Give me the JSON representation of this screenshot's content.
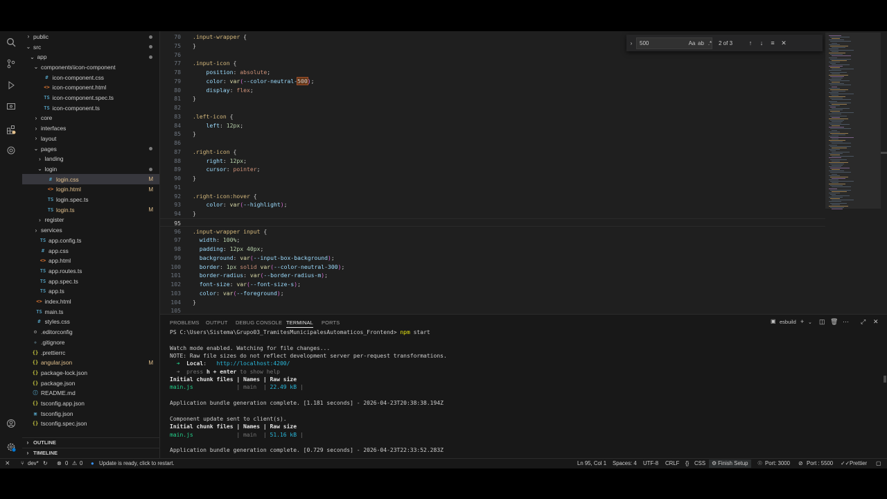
{
  "explorer": {
    "items": [
      {
        "label": "public",
        "icon": "chevron-right",
        "depth": 0,
        "type": "folder",
        "dot": true
      },
      {
        "label": "src",
        "icon": "chevron-down",
        "depth": 0,
        "type": "folder",
        "dot": true
      },
      {
        "label": "app",
        "icon": "chevron-down",
        "depth": 1,
        "type": "folder",
        "dot": true
      },
      {
        "label": "components\\icon-component",
        "icon": "chevron-down",
        "depth": 2,
        "type": "folder"
      },
      {
        "label": "icon-component.css",
        "icon": "css-icon",
        "depth": 3,
        "type": "file"
      },
      {
        "label": "icon-component.html",
        "icon": "html-icon",
        "depth": 3,
        "type": "file"
      },
      {
        "label": "icon-component.spec.ts",
        "icon": "ts-icon",
        "depth": 3,
        "type": "file"
      },
      {
        "label": "icon-component.ts",
        "icon": "ts-icon",
        "depth": 3,
        "type": "file"
      },
      {
        "label": "core",
        "icon": "chevron-right",
        "depth": 2,
        "type": "folder"
      },
      {
        "label": "interfaces",
        "icon": "chevron-right",
        "depth": 2,
        "type": "folder"
      },
      {
        "label": "layout",
        "icon": "chevron-right",
        "depth": 2,
        "type": "folder"
      },
      {
        "label": "pages",
        "icon": "chevron-down",
        "depth": 2,
        "type": "folder",
        "dot": true
      },
      {
        "label": "landing",
        "icon": "chevron-right",
        "depth": 3,
        "type": "folder"
      },
      {
        "label": "login",
        "icon": "chevron-down",
        "depth": 3,
        "type": "folder",
        "dot": true
      },
      {
        "label": "login.css",
        "icon": "css-icon",
        "depth": 4,
        "type": "file",
        "mod": "M",
        "selected": true
      },
      {
        "label": "login.html",
        "icon": "html-icon",
        "depth": 4,
        "type": "file",
        "mod": "M"
      },
      {
        "label": "login.spec.ts",
        "icon": "ts-icon",
        "depth": 4,
        "type": "file"
      },
      {
        "label": "login.ts",
        "icon": "ts-icon",
        "depth": 4,
        "type": "file",
        "mod": "M"
      },
      {
        "label": "register",
        "icon": "chevron-right",
        "depth": 3,
        "type": "folder"
      },
      {
        "label": "services",
        "icon": "chevron-right",
        "depth": 2,
        "type": "folder"
      },
      {
        "label": "app.config.ts",
        "icon": "ts-icon",
        "depth": 2,
        "type": "file"
      },
      {
        "label": "app.css",
        "icon": "css-icon",
        "depth": 2,
        "type": "file"
      },
      {
        "label": "app.html",
        "icon": "html-icon",
        "depth": 2,
        "type": "file"
      },
      {
        "label": "app.routes.ts",
        "icon": "ts-icon",
        "depth": 2,
        "type": "file"
      },
      {
        "label": "app.spec.ts",
        "icon": "ts-icon",
        "depth": 2,
        "type": "file"
      },
      {
        "label": "app.ts",
        "icon": "ts-icon",
        "depth": 2,
        "type": "file"
      },
      {
        "label": "index.html",
        "icon": "html-icon",
        "depth": 1,
        "type": "file"
      },
      {
        "label": "main.ts",
        "icon": "ts-icon",
        "depth": 1,
        "type": "file"
      },
      {
        "label": "styles.css",
        "icon": "css-icon",
        "depth": 1,
        "type": "file"
      },
      {
        "label": ".editorconfig",
        "icon": "gear-icon",
        "depth": 0,
        "type": "file"
      },
      {
        "label": ".gitignore",
        "icon": "git-icon",
        "depth": 0,
        "type": "file"
      },
      {
        "label": ".prettierrc",
        "icon": "json-icon",
        "depth": 0,
        "type": "file"
      },
      {
        "label": "angular.json",
        "icon": "json-icon",
        "depth": 0,
        "type": "file",
        "mod": "M"
      },
      {
        "label": "package-lock.json",
        "icon": "json-icon",
        "depth": 0,
        "type": "file"
      },
      {
        "label": "package.json",
        "icon": "json-icon",
        "depth": 0,
        "type": "file"
      },
      {
        "label": "README.md",
        "icon": "info-icon",
        "depth": 0,
        "type": "file"
      },
      {
        "label": "tsconfig.app.json",
        "icon": "json-icon",
        "depth": 0,
        "type": "file"
      },
      {
        "label": "tsconfig.json",
        "icon": "tsconfig-icon",
        "depth": 0,
        "type": "file"
      },
      {
        "label": "tsconfig.spec.json",
        "icon": "json-icon",
        "depth": 0,
        "type": "file"
      }
    ],
    "outline_label": "OUTLINE",
    "timeline_label": "TIMELINE"
  },
  "editor": {
    "lines": [
      {
        "n": "70",
        "tokens": [
          [
            "sel",
            ".input-wrapper"
          ],
          [
            "punc",
            " {"
          ]
        ]
      },
      {
        "n": "75",
        "tokens": [
          [
            "punc",
            "}"
          ]
        ]
      },
      {
        "n": "76",
        "tokens": []
      },
      {
        "n": "77",
        "tokens": [
          [
            "sel",
            ".input-icon"
          ],
          [
            "punc",
            " {"
          ]
        ]
      },
      {
        "n": "78",
        "tokens": [
          [
            "punc",
            "    "
          ],
          [
            "prop",
            "position"
          ],
          [
            "punc",
            ": "
          ],
          [
            "val",
            "absolute"
          ],
          [
            "punc",
            ";"
          ]
        ]
      },
      {
        "n": "79",
        "tokens": [
          [
            "punc",
            "    "
          ],
          [
            "prop",
            "color"
          ],
          [
            "punc",
            ": "
          ],
          [
            "fn",
            "var"
          ],
          [
            "brace",
            "("
          ],
          [
            "var",
            "--color-neutral-"
          ],
          [
            "hl",
            "500"
          ],
          [
            "brace",
            ")"
          ],
          [
            "punc",
            ";"
          ]
        ]
      },
      {
        "n": "80",
        "tokens": [
          [
            "punc",
            "    "
          ],
          [
            "prop",
            "display"
          ],
          [
            "punc",
            ": "
          ],
          [
            "val",
            "flex"
          ],
          [
            "punc",
            ";"
          ]
        ]
      },
      {
        "n": "81",
        "tokens": [
          [
            "punc",
            "}"
          ]
        ]
      },
      {
        "n": "82",
        "tokens": []
      },
      {
        "n": "83",
        "tokens": [
          [
            "sel",
            ".left-icon"
          ],
          [
            "punc",
            " {"
          ]
        ]
      },
      {
        "n": "84",
        "tokens": [
          [
            "punc",
            "    "
          ],
          [
            "prop",
            "left"
          ],
          [
            "punc",
            ": "
          ],
          [
            "num",
            "12px"
          ],
          [
            "punc",
            ";"
          ]
        ]
      },
      {
        "n": "85",
        "tokens": [
          [
            "punc",
            "}"
          ]
        ]
      },
      {
        "n": "86",
        "tokens": []
      },
      {
        "n": "87",
        "tokens": [
          [
            "sel",
            ".right-icon"
          ],
          [
            "punc",
            " {"
          ]
        ]
      },
      {
        "n": "88",
        "tokens": [
          [
            "punc",
            "    "
          ],
          [
            "prop",
            "right"
          ],
          [
            "punc",
            ": "
          ],
          [
            "num",
            "12px"
          ],
          [
            "punc",
            ";"
          ]
        ]
      },
      {
        "n": "89",
        "tokens": [
          [
            "punc",
            "    "
          ],
          [
            "prop",
            "cursor"
          ],
          [
            "punc",
            ": "
          ],
          [
            "val",
            "pointer"
          ],
          [
            "punc",
            ";"
          ]
        ]
      },
      {
        "n": "90",
        "tokens": [
          [
            "punc",
            "}"
          ]
        ]
      },
      {
        "n": "91",
        "tokens": []
      },
      {
        "n": "92",
        "tokens": [
          [
            "sel",
            ".right-icon:hover"
          ],
          [
            "punc",
            " {"
          ]
        ]
      },
      {
        "n": "93",
        "tokens": [
          [
            "punc",
            "    "
          ],
          [
            "prop",
            "color"
          ],
          [
            "punc",
            ": "
          ],
          [
            "fn",
            "var"
          ],
          [
            "brace",
            "("
          ],
          [
            "var",
            "--highlight"
          ],
          [
            "brace",
            ")"
          ],
          [
            "punc",
            ";"
          ]
        ]
      },
      {
        "n": "94",
        "tokens": [
          [
            "punc",
            "}"
          ]
        ]
      },
      {
        "n": "95",
        "tokens": [],
        "current": true
      },
      {
        "n": "96",
        "tokens": [
          [
            "sel",
            ".input-wrapper input"
          ],
          [
            "punc",
            " {"
          ]
        ]
      },
      {
        "n": "97",
        "tokens": [
          [
            "punc",
            "  "
          ],
          [
            "prop",
            "width"
          ],
          [
            "punc",
            ": "
          ],
          [
            "num",
            "100%"
          ],
          [
            "punc",
            ";"
          ]
        ]
      },
      {
        "n": "98",
        "tokens": [
          [
            "punc",
            "  "
          ],
          [
            "prop",
            "padding"
          ],
          [
            "punc",
            ": "
          ],
          [
            "num",
            "12px 40px"
          ],
          [
            "punc",
            ";"
          ]
        ]
      },
      {
        "n": "99",
        "tokens": [
          [
            "punc",
            "  "
          ],
          [
            "prop",
            "background"
          ],
          [
            "punc",
            ": "
          ],
          [
            "fn",
            "var"
          ],
          [
            "brace",
            "("
          ],
          [
            "var",
            "--input-box-background"
          ],
          [
            "brace",
            ")"
          ],
          [
            "punc",
            ";"
          ]
        ]
      },
      {
        "n": "100",
        "tokens": [
          [
            "punc",
            "  "
          ],
          [
            "prop",
            "border"
          ],
          [
            "punc",
            ": "
          ],
          [
            "num",
            "1px"
          ],
          [
            "val",
            " solid "
          ],
          [
            "fn",
            "var"
          ],
          [
            "brace",
            "("
          ],
          [
            "var",
            "--color-neutral-300"
          ],
          [
            "brace",
            ")"
          ],
          [
            "punc",
            ";"
          ]
        ]
      },
      {
        "n": "101",
        "tokens": [
          [
            "punc",
            "  "
          ],
          [
            "prop",
            "border-radius"
          ],
          [
            "punc",
            ": "
          ],
          [
            "fn",
            "var"
          ],
          [
            "brace",
            "("
          ],
          [
            "var",
            "--border-radius-m"
          ],
          [
            "brace",
            ")"
          ],
          [
            "punc",
            ";"
          ]
        ]
      },
      {
        "n": "102",
        "tokens": [
          [
            "punc",
            "  "
          ],
          [
            "prop",
            "font-size"
          ],
          [
            "punc",
            ": "
          ],
          [
            "fn",
            "var"
          ],
          [
            "brace",
            "("
          ],
          [
            "var",
            "--font-size-s"
          ],
          [
            "brace",
            ")"
          ],
          [
            "punc",
            ";"
          ]
        ]
      },
      {
        "n": "103",
        "tokens": [
          [
            "punc",
            "  "
          ],
          [
            "prop",
            "color"
          ],
          [
            "punc",
            ": "
          ],
          [
            "fn",
            "var"
          ],
          [
            "brace",
            "("
          ],
          [
            "var",
            "--foreground"
          ],
          [
            "brace",
            ")"
          ],
          [
            "punc",
            ";"
          ]
        ]
      },
      {
        "n": "104",
        "tokens": [
          [
            "punc",
            "}"
          ]
        ]
      },
      {
        "n": "105",
        "tokens": []
      }
    ],
    "find": {
      "value": "500",
      "count": "2 of 3",
      "match_case": "Aa",
      "whole_word": "ab",
      "regex": ".*"
    }
  },
  "panel": {
    "tabs": [
      "PROBLEMS",
      "OUTPUT",
      "DEBUG CONSOLE",
      "TERMINAL",
      "PORTS"
    ],
    "active_tab": "TERMINAL",
    "terminal_name": "esbuild",
    "terminal": [
      [
        [
          "",
          "PS C:\\Users\\Sistema\\Grupo03_TramitesMunicipalesAutomaticos_Frontend> "
        ],
        [
          "t-yellow",
          "npm"
        ],
        [
          "",
          " start"
        ]
      ],
      [],
      [
        [
          "",
          "Watch mode enabled. Watching for file changes..."
        ]
      ],
      [
        [
          "",
          "NOTE: Raw file sizes do not reflect development server per-request transformations."
        ]
      ],
      [
        [
          "t-green",
          "  ➜  "
        ],
        [
          "t-bold",
          "Local"
        ],
        [
          "",
          ":   "
        ],
        [
          "t-cyan",
          "http://localhost:4200/"
        ]
      ],
      [
        [
          "t-dim",
          "  ➜  press "
        ],
        [
          "t-bold",
          "h + enter"
        ],
        [
          "t-dim",
          " to show help"
        ]
      ],
      [
        [
          "t-bold",
          "Initial chunk files | Names | Raw size"
        ]
      ],
      [
        [
          "t-green",
          "main.js"
        ],
        [
          "t-dim",
          "             | "
        ],
        [
          "t-dim",
          "main"
        ],
        [
          "t-dim",
          "  | "
        ],
        [
          "t-cyan",
          "22.49 kB"
        ],
        [
          "t-dim",
          " |"
        ]
      ],
      [],
      [
        [
          "",
          "Application bundle generation complete. [1.181 seconds] - 2026-04-23T20:38:38.194Z"
        ]
      ],
      [],
      [
        [
          "",
          "Component update sent to client(s)."
        ]
      ],
      [
        [
          "t-bold",
          "Initial chunk files | Names | Raw size"
        ]
      ],
      [
        [
          "t-green",
          "main.js"
        ],
        [
          "t-dim",
          "             | "
        ],
        [
          "t-dim",
          "main"
        ],
        [
          "t-dim",
          "  | "
        ],
        [
          "t-cyan",
          "51.16 kB"
        ],
        [
          "t-dim",
          " |"
        ]
      ],
      [],
      [
        [
          "",
          "Application bundle generation complete. [0.729 seconds] - 2026-04-23T22:33:52.283Z"
        ]
      ]
    ]
  },
  "statusbar": {
    "branch": "dev*",
    "errors": "0",
    "warnings": "0",
    "update_text": "Update is ready, click to restart.",
    "position": "Ln 95, Col 1",
    "spaces": "Spaces: 4",
    "encoding": "UTF-8",
    "eol": "CRLF",
    "language": "CSS",
    "finish_setup": "Finish Setup",
    "port1": "Port: 3000",
    "port2": "Port : 5500",
    "prettier": "Prettier"
  }
}
